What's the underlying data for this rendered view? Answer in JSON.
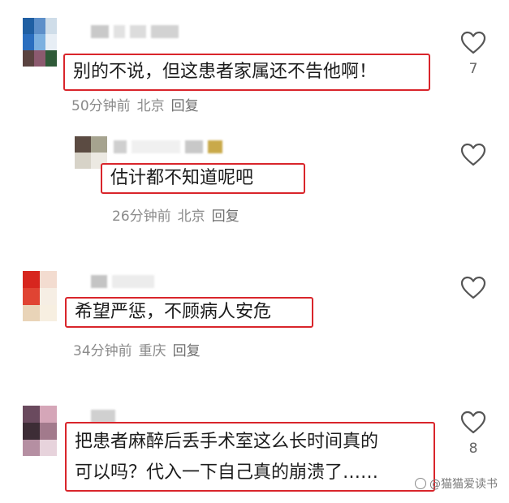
{
  "comments": [
    {
      "text": "别的不说，但这患者家属还不告他啊！",
      "time": "50分钟前",
      "location": "北京",
      "reply": "回复",
      "likes": "7"
    },
    {
      "text": "估计都不知道呢吧",
      "time": "26分钟前",
      "location": "北京",
      "reply": "回复",
      "likes": ""
    },
    {
      "text": "希望严惩，不顾病人安危",
      "time": "34分钟前",
      "location": "重庆",
      "reply": "回复",
      "likes": ""
    },
    {
      "text_line1": "把患者麻醉后丢手术室这么长时间真的",
      "text_line2": "可以吗？代入一下自己真的崩溃了……",
      "likes": "8"
    }
  ],
  "watermark": "@猫猫爱读书",
  "icons": {
    "like": "heart-outline-icon",
    "watermark_logo": "weibo-logo-icon"
  },
  "colors": {
    "highlight_border": "#d9252b",
    "meta_text": "#8a8a8a"
  }
}
